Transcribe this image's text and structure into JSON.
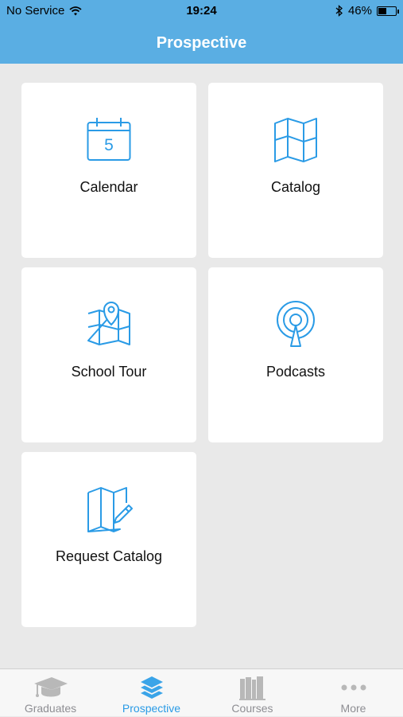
{
  "status": {
    "carrier": "No Service",
    "time": "19:24",
    "battery": "46%",
    "battery_level": 0.46
  },
  "nav": {
    "title": "Prospective"
  },
  "tiles": [
    {
      "label": "Calendar",
      "icon": "calendar-icon",
      "day": "5"
    },
    {
      "label": "Catalog",
      "icon": "map-icon"
    },
    {
      "label": "School Tour",
      "icon": "map-pin-icon"
    },
    {
      "label": "Podcasts",
      "icon": "podcast-icon"
    },
    {
      "label": "Request Catalog",
      "icon": "map-edit-icon"
    }
  ],
  "tabs": [
    {
      "label": "Graduates",
      "icon": "graduation-cap-icon",
      "active": false
    },
    {
      "label": "Prospective",
      "icon": "layers-icon",
      "active": true
    },
    {
      "label": "Courses",
      "icon": "books-icon",
      "active": false
    },
    {
      "label": "More",
      "icon": "more-dots-icon",
      "active": false
    }
  ],
  "colors": {
    "accent": "#5aaee3",
    "icon": "#2a9be6",
    "tab_inactive": "#8e8e93",
    "background": "#e9e9e9"
  }
}
